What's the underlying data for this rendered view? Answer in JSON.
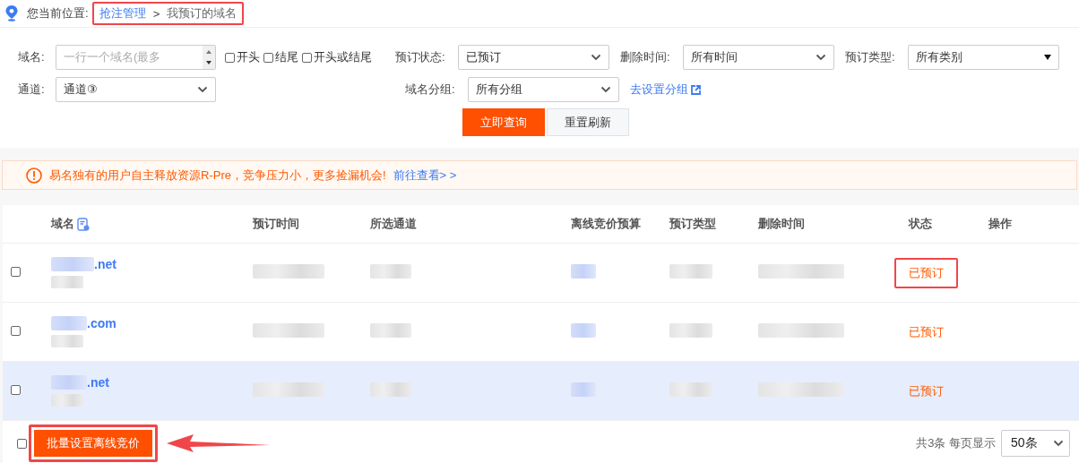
{
  "breadcrumb": {
    "label": "您当前位置:",
    "items": [
      {
        "text": "抢注管理",
        "kind": "link"
      },
      {
        "text": ">",
        "kind": "separator"
      },
      {
        "text": "我预订的域名",
        "kind": "current"
      }
    ],
    "highlighted": true
  },
  "filters": {
    "domain": {
      "label": "域名:",
      "placeholder": "一行一个域名(最多"
    },
    "match_options": [
      {
        "label": "开头",
        "checked": false
      },
      {
        "label": "结尾",
        "checked": false
      },
      {
        "label": "开头或结尾",
        "checked": false
      }
    ],
    "status": {
      "label": "预订状态:",
      "value": "已预订"
    },
    "delete_time": {
      "label": "删除时间:",
      "value": "所有时间"
    },
    "type": {
      "label": "预订类型:",
      "value": "所有类别"
    },
    "channel": {
      "label": "通道:",
      "value": "通道③"
    },
    "group": {
      "label": "域名分组:",
      "value": "所有分组"
    },
    "group_link": "去设置分组",
    "buttons": [
      {
        "label": "立即查询",
        "kind": "primary"
      },
      {
        "label": "重置刷新",
        "kind": "secondary"
      }
    ]
  },
  "notice": {
    "text": "易名独有的用户自主释放资源R-Pre，竞争压力小，更多捡漏机会!",
    "link": "前往查看> >"
  },
  "table": {
    "columns": [
      "域名",
      "预订时间",
      "所选通道",
      "离线竞价预算",
      "预订类型",
      "删除时间",
      "状态",
      "操作"
    ],
    "rows": [
      {
        "checked": false,
        "domain_suffix": ".net",
        "status": "已预订",
        "status_highlighted": true,
        "hovered": false
      },
      {
        "checked": false,
        "domain_suffix": ".com",
        "status": "已预订",
        "status_highlighted": false,
        "hovered": false
      },
      {
        "checked": false,
        "domain_suffix": ".net",
        "status": "已预订",
        "status_highlighted": false,
        "hovered": true
      }
    ]
  },
  "footer": {
    "select_all_checked": false,
    "bulk_button": "批量设置离线竞价",
    "bulk_highlighted": true,
    "total": "共3条 每页显示",
    "page_size": "50条"
  }
}
